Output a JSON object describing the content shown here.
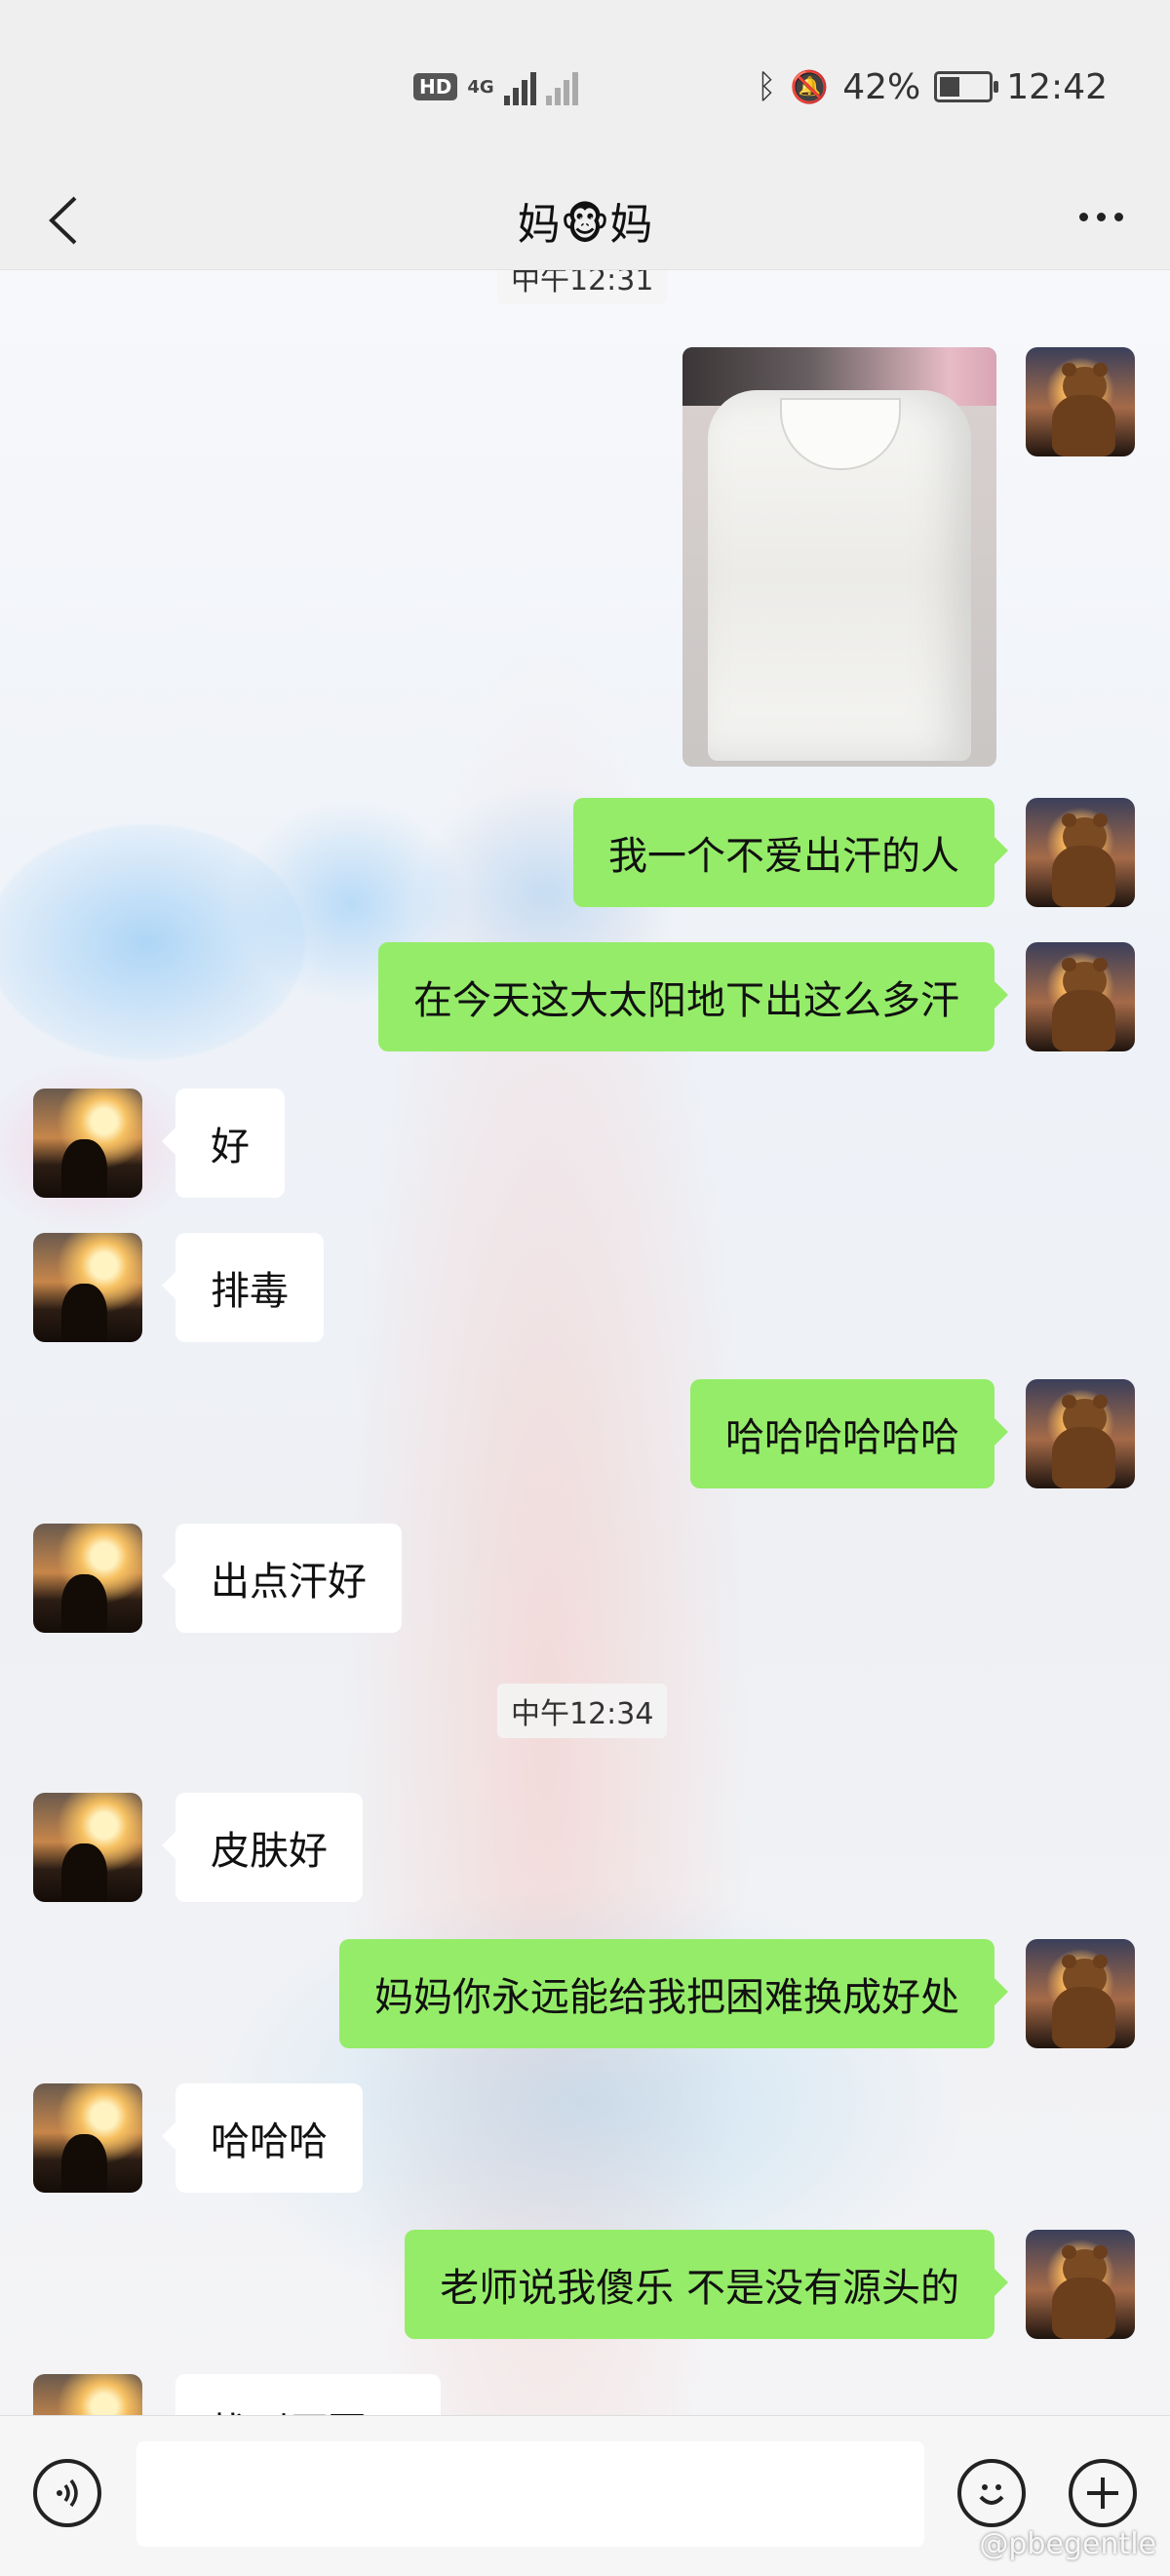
{
  "status_bar": {
    "hd_label": "HD",
    "network_label": "4G",
    "battery_percent_text": "42%",
    "battery_level": 0.42,
    "time": "12:42"
  },
  "header": {
    "title": "妈🐵妈",
    "back_icon": "chevron-left-icon",
    "more_icon": "more-dots-icon"
  },
  "messages": {
    "timestamp_top": "中午12:31",
    "photo_alt": "white dress on hanger",
    "m1": "我一个不爱出汗的人",
    "m2": "在今天这大太阳地下出这么多汗",
    "m3": "好",
    "m4": "排毒",
    "m5": "哈哈哈哈哈哈",
    "m6": "出点汗好",
    "timestamp_mid": "中午12:34",
    "m7": "皮肤好",
    "m8": "妈妈你永远能给我把困难换成好处",
    "m9": "哈哈哈",
    "m10": "老师说我傻乐 不是没有源头的",
    "m11_partial": "找到原因了"
  },
  "input_bar": {
    "voice_icon": "voice-icon",
    "emoji_icon": "emoji-icon",
    "plus_icon": "plus-icon",
    "text_value": ""
  },
  "watermark": "@pbegentle",
  "colors": {
    "outgoing_bubble": "#95ec69",
    "incoming_bubble": "#ffffff",
    "bar_background": "#efefef"
  }
}
